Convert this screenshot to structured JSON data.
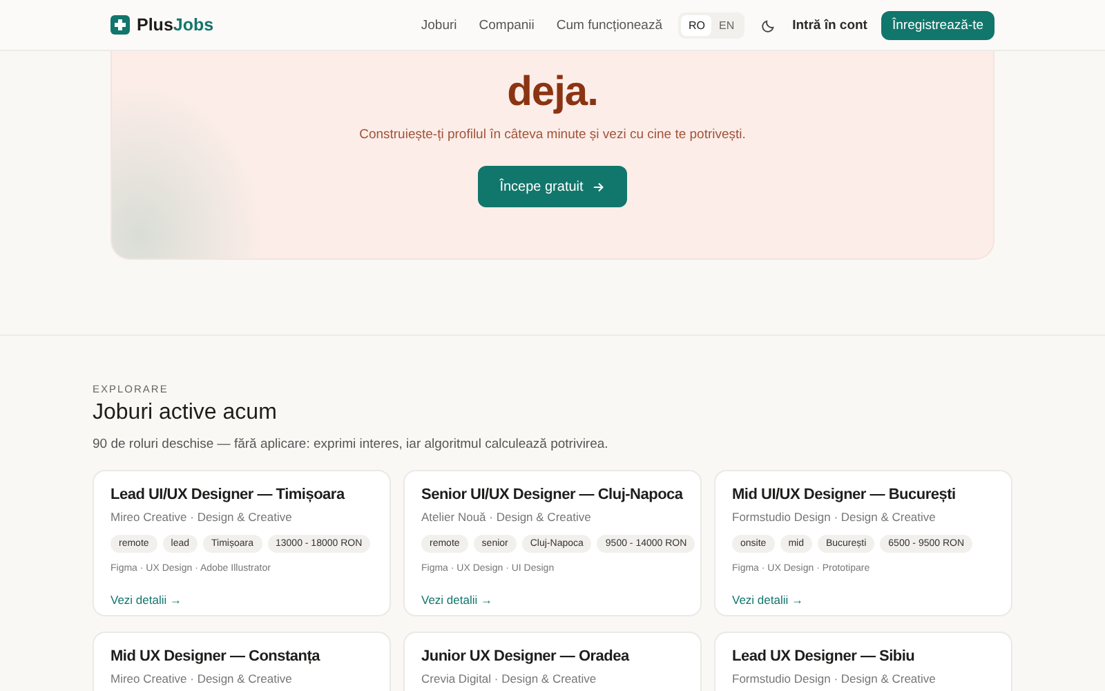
{
  "header": {
    "logo": {
      "prefix": "Plus",
      "suffix": "Jobs"
    },
    "nav": [
      {
        "label": "Joburi"
      },
      {
        "label": "Companii"
      },
      {
        "label": "Cum funcționează"
      }
    ],
    "languages": [
      {
        "label": "RO",
        "selected": true
      },
      {
        "label": "EN",
        "selected": false
      }
    ],
    "login": "Intră în cont",
    "register": "Înregistrează-te"
  },
  "hero": {
    "heading_lines": [
      "deja."
    ],
    "subtitle": "Construiește-ți profilul în câteva minute și vezi cu cine te potrivești.",
    "cta": "Începe gratuit"
  },
  "jobs_section": {
    "eyebrow": "EXPLORARE",
    "title": "Joburi active acum",
    "description": "90 de roluri deschise — fără aplicare: exprimi interes, iar algoritmul calculează potrivirea.",
    "jobs": [
      {
        "title": "Lead UI/UX Designer — Timișoara",
        "company": "Mireo Creative · Design & Creative",
        "tags": [
          "remote",
          "lead",
          "Timișoara",
          "13000 - 18000 RON"
        ],
        "skills": "Figma · UX Design · Adobe Illustrator",
        "link": "Vezi detalii →"
      },
      {
        "title": "Senior UI/UX Designer — Cluj-Napoca",
        "company": "Atelier Nouă · Design & Creative",
        "tags": [
          "remote",
          "senior",
          "Cluj-Napoca",
          "9500 - 14000 RON"
        ],
        "skills": "Figma · UX Design · UI Design",
        "link": "Vezi detalii →"
      },
      {
        "title": "Mid UI/UX Designer — București",
        "company": "Formstudio Design · Design & Creative",
        "tags": [
          "onsite",
          "mid",
          "București",
          "6500 - 9500 RON"
        ],
        "skills": "Figma · UX Design · Prototipare",
        "link": "Vezi detalii →"
      },
      {
        "title": "Mid UX Designer — Constanța",
        "company": "Mireo Creative · Design & Creative"
      },
      {
        "title": "Junior UX Designer — Oradea",
        "company": "Crevia Digital · Design & Creative"
      },
      {
        "title": "Lead UX Designer — Sibiu",
        "company": "Formstudio Design · Design & Creative"
      }
    ]
  }
}
